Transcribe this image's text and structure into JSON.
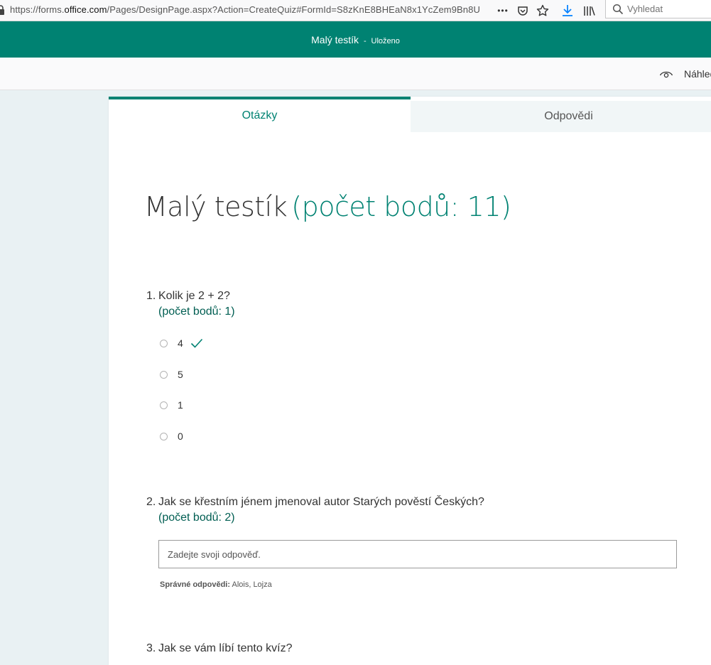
{
  "browser": {
    "url_prefix": "https://forms.",
    "url_domain": "office.com",
    "url_rest": "/Pages/DesignPage.aspx?Action=CreateQuiz#FormId=S8zKnE8BHEaN8x1YcZem9Bn8U",
    "more_label": "•••",
    "search_placeholder": "Vyhledat"
  },
  "header": {
    "title": "Malý testík",
    "separator": "-",
    "saved": "Uloženo"
  },
  "toolbar": {
    "preview_label": "Náhled"
  },
  "tabs": {
    "questions": "Otázky",
    "responses": "Odpovědi"
  },
  "form": {
    "title": "Malý testík",
    "points": "(počet bodů: 11)"
  },
  "questions": [
    {
      "number": "1.",
      "text": "Kolik je 2 + 2?",
      "points": "(počet bodů: 1)",
      "options": [
        "4",
        "5",
        "1",
        "0"
      ],
      "correct_index": 0
    },
    {
      "number": "2.",
      "text": "Jak se křestním jénem jmenoval autor Starých pověstí Českých?",
      "points": "(počet bodů: 2)",
      "answer_placeholder": "Zadejte svoji odpověď.",
      "correct_label": "Správné odpovědi:",
      "correct_values": "Alois, Lojza"
    },
    {
      "number": "3.",
      "text": "Jak se vám líbí tento kvíz?"
    }
  ],
  "colors": {
    "brand": "#008272",
    "points": "#008272",
    "background": "#e9f1f3"
  }
}
